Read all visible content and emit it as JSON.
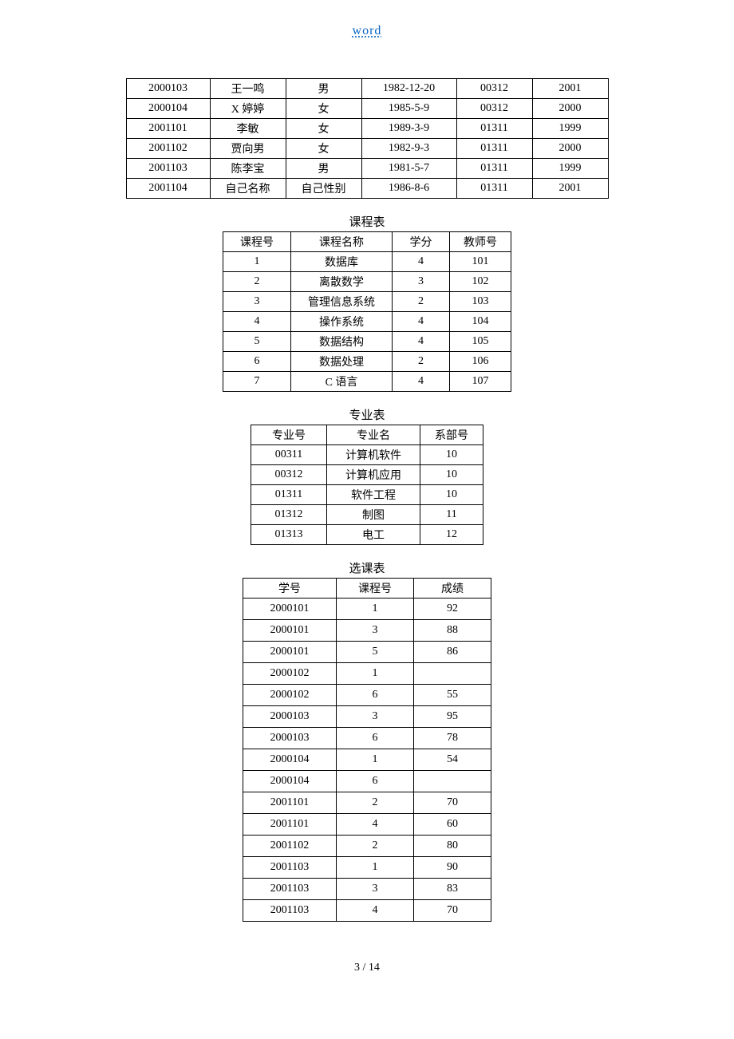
{
  "header": {
    "link_text": "word"
  },
  "footer": {
    "page": "3 / 14"
  },
  "table1": {
    "rows": [
      [
        "2000103",
        "王一鸣",
        "男",
        "1982-12-20",
        "00312",
        "2001"
      ],
      [
        "2000104",
        "X 婷婷",
        "女",
        "1985-5-9",
        "00312",
        "2000"
      ],
      [
        "2001101",
        "李敏",
        "女",
        "1989-3-9",
        "01311",
        "1999"
      ],
      [
        "2001102",
        "贾向男",
        "女",
        "1982-9-3",
        "01311",
        "2000"
      ],
      [
        "2001103",
        "陈李宝",
        "男",
        "1981-5-7",
        "01311",
        "1999"
      ],
      [
        "2001104",
        "自己名称",
        "自己性别",
        "1986-8-6",
        "01311",
        "2001"
      ]
    ]
  },
  "table2": {
    "caption": "课程表",
    "headers": [
      "课程号",
      "课程名称",
      "学分",
      "教师号"
    ],
    "rows": [
      [
        "1",
        "数据库",
        "4",
        "101"
      ],
      [
        "2",
        "离散数学",
        "3",
        "102"
      ],
      [
        "3",
        "管理信息系统",
        "2",
        "103"
      ],
      [
        "4",
        "操作系统",
        "4",
        "104"
      ],
      [
        "5",
        "数据结构",
        "4",
        "105"
      ],
      [
        "6",
        "数据处理",
        "2",
        "106"
      ],
      [
        "7",
        "C 语言",
        "4",
        "107"
      ]
    ]
  },
  "table3": {
    "caption": "专业表",
    "headers": [
      "专业号",
      "专业名",
      "系部号"
    ],
    "rows": [
      [
        "00311",
        "计算机软件",
        "10"
      ],
      [
        "00312",
        "计算机应用",
        "10"
      ],
      [
        "01311",
        "软件工程",
        "10"
      ],
      [
        "01312",
        "制图",
        "11"
      ],
      [
        "01313",
        "电工",
        "12"
      ]
    ]
  },
  "table4": {
    "caption": "选课表",
    "headers": [
      "学号",
      "课程号",
      "成绩"
    ],
    "rows": [
      [
        "2000101",
        "1",
        "92"
      ],
      [
        "2000101",
        "3",
        "88"
      ],
      [
        "2000101",
        "5",
        "86"
      ],
      [
        "2000102",
        "1",
        ""
      ],
      [
        "2000102",
        "6",
        "55"
      ],
      [
        "2000103",
        "3",
        "95"
      ],
      [
        "2000103",
        "6",
        "78"
      ],
      [
        "2000104",
        "1",
        "54"
      ],
      [
        "2000104",
        "6",
        ""
      ],
      [
        "2001101",
        "2",
        "70"
      ],
      [
        "2001101",
        "4",
        "60"
      ],
      [
        "2001102",
        "2",
        "80"
      ],
      [
        "2001103",
        "1",
        "90"
      ],
      [
        "2001103",
        "3",
        "83"
      ],
      [
        "2001103",
        "4",
        "70"
      ]
    ]
  }
}
